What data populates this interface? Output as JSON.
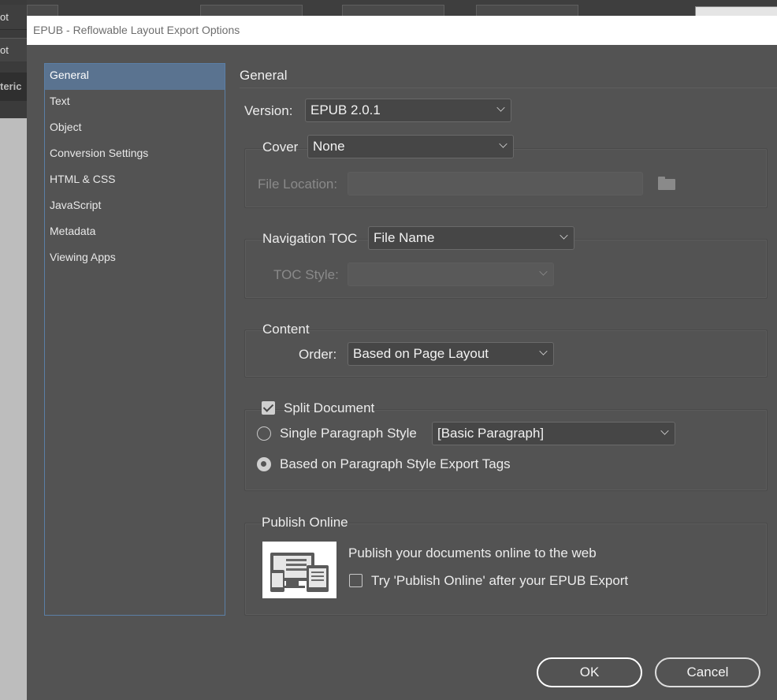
{
  "background_app": {
    "left_labels": [
      "ot",
      "ot",
      "teric"
    ]
  },
  "dialog": {
    "title": "EPUB - Reflowable Layout Export Options"
  },
  "sidebar": {
    "items": [
      {
        "label": "General",
        "active": true
      },
      {
        "label": "Text",
        "active": false
      },
      {
        "label": "Object",
        "active": false
      },
      {
        "label": "Conversion Settings",
        "active": false
      },
      {
        "label": "HTML & CSS",
        "active": false
      },
      {
        "label": "JavaScript",
        "active": false
      },
      {
        "label": "Metadata",
        "active": false
      },
      {
        "label": "Viewing Apps",
        "active": false
      }
    ]
  },
  "general": {
    "heading": "General",
    "version_label": "Version:",
    "version_value": "EPUB 2.0.1",
    "cover_label": "Cover",
    "cover_value": "None",
    "file_location_label": "File Location:",
    "file_location_value": "",
    "nav_toc_label": "Navigation TOC",
    "nav_toc_value": "File Name",
    "toc_style_label": "TOC Style:",
    "toc_style_value": "",
    "content_label": "Content",
    "order_label": "Order:",
    "order_value": "Based on Page Layout",
    "split_document_label": "Split Document",
    "split_document_checked": true,
    "single_paragraph_style_label": "Single Paragraph Style",
    "single_paragraph_style_value": "[Basic Paragraph]",
    "based_on_export_tags_label": "Based on Paragraph Style Export Tags",
    "split_mode_selected": "based_on_export_tags",
    "publish_online_label": "Publish Online",
    "publish_online_text": "Publish your documents online to the web",
    "try_publish_label": "Try 'Publish Online' after your EPUB Export",
    "try_publish_checked": false
  },
  "buttons": {
    "ok": "OK",
    "cancel": "Cancel"
  },
  "colors": {
    "dialog_bg": "#535353",
    "nav_selected_bg": "#5a7390",
    "nav_border": "#5b7fa6"
  }
}
